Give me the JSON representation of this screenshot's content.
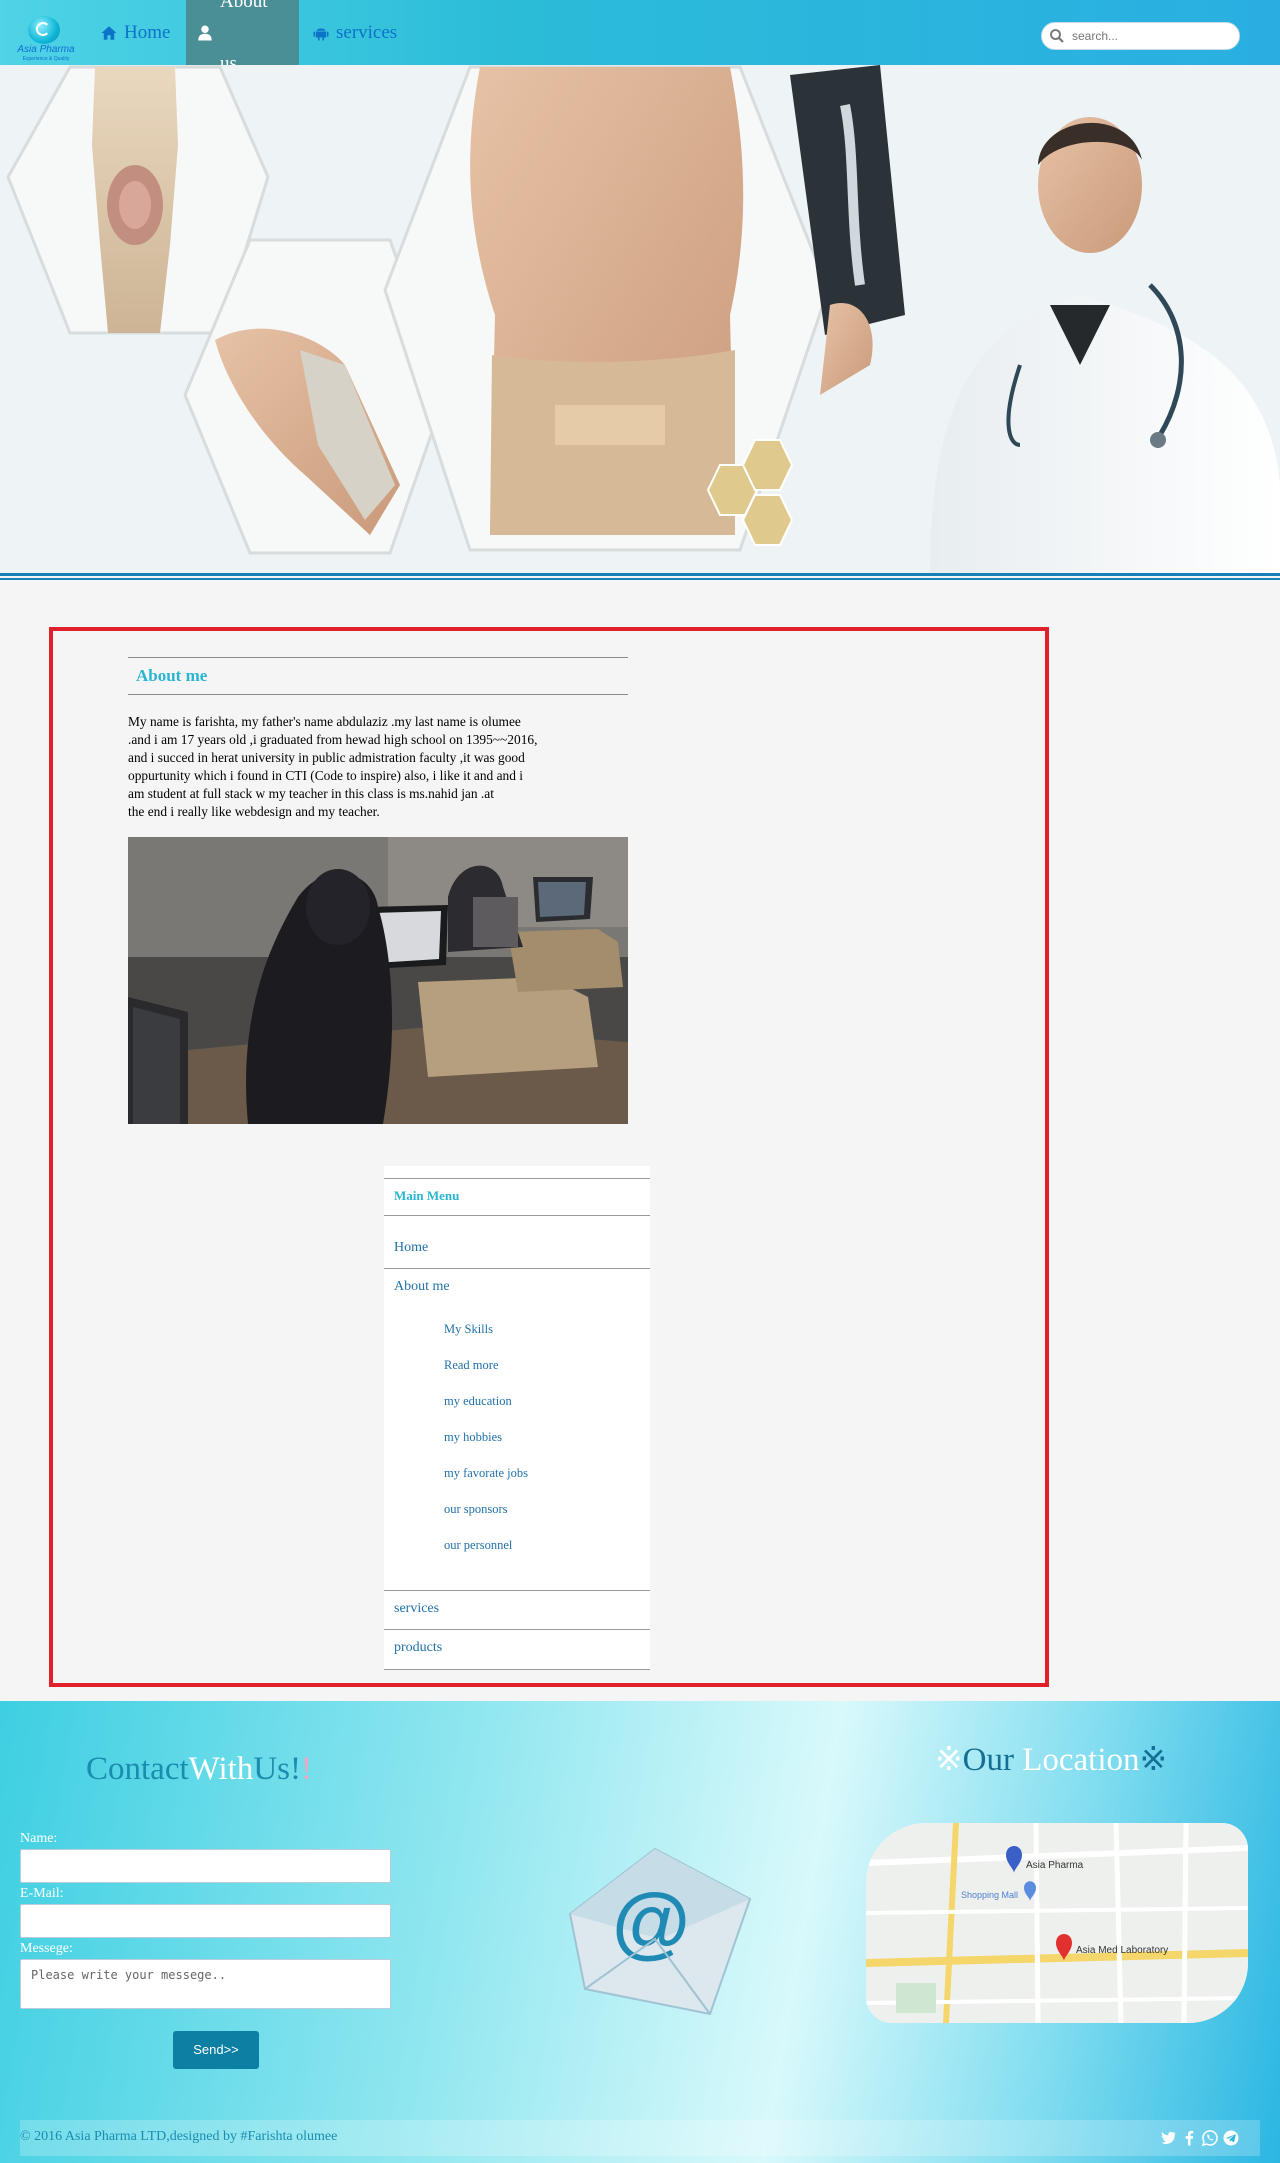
{
  "nav": {
    "logo_name": "Asia Pharma",
    "logo_tagline": "Experience & Quality",
    "items": [
      {
        "label": "Home"
      },
      {
        "label": "About us"
      },
      {
        "label": "services"
      }
    ],
    "search_placeholder": "search..."
  },
  "about": {
    "heading": "About me",
    "text": "My name is farishta, my father's name abdulaziz .my last name is olumee\n.and i am 17 years old ,i graduated from hewad high school on 1395~~2016,\nand i succed in herat university in public admistration faculty ,it was good\noppurtunity which i found in CTI (Code to inspire) also, i like it and and i\nam student at full stack w my teacher in this class is ms.nahid jan .at\nthe end i really like webdesign and my teacher."
  },
  "menu": {
    "title": "Main Menu",
    "items": [
      "Home",
      "About me",
      "services",
      "products"
    ],
    "sub_items": [
      "My Skills",
      "Read more",
      "my education",
      "my hobbies",
      "my favorate jobs",
      "our sponsors",
      "our personnel"
    ]
  },
  "footer": {
    "contact_title_a": "Contact",
    "contact_title_b": "With",
    "contact_title_c": "Us!",
    "contact_title_d": "!",
    "location_title_a": "※",
    "location_title_b": "Our",
    "location_title_c": " Location",
    "location_title_d": "※",
    "name_label": "Name:",
    "email_label": "E-Mail:",
    "message_label": "Messege:",
    "message_placeholder": "Please write your messege..",
    "send_label": "Send>>",
    "copyright": "© 2016 Asia Pharma LTD,designed by #Farishta olumee",
    "map_labels": [
      "Asia Pharma",
      "Shopping Mall",
      "Asia Med Laboratory"
    ]
  },
  "colors": {
    "accent": "#2ab5d3",
    "nav_active": "#4a8f96",
    "frame": "#e0202a",
    "link": "#2171a8"
  }
}
